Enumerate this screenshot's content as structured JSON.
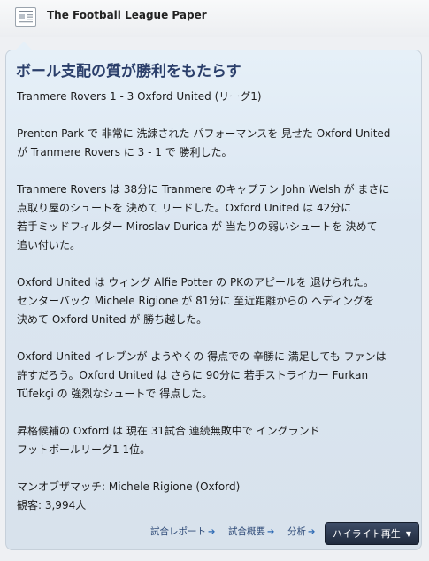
{
  "header": {
    "icon": "newspaper-icon",
    "title": "The Football League Paper"
  },
  "article": {
    "headline": "ボール支配の質が勝利をもたらす",
    "subtitle": "Tranmere Rovers 1 - 3 Oxford United (リーグ1)",
    "p1": [
      "Prenton Park で 非常に 洗練された パフォーマンスを 見せた Oxford United",
      "が Tranmere Rovers に 3 - 1 で 勝利した。"
    ],
    "p2": [
      "Tranmere Rovers は 38分に Tranmere のキャプテン John Welsh が まさに",
      "点取り屋のシュートを 決めて リードした。Oxford United は 42分に",
      "若手ミッドフィルダー Miroslav Durica が 当たりの弱いシュートを 決めて",
      "追い付いた。"
    ],
    "p3": [
      "Oxford United は ウィング Alfie Potter の PKのアピールを 退けられた。",
      "センターバック Michele Rigione が 81分に 至近距離からの ヘディングを",
      "決めて Oxford United が 勝ち越した。"
    ],
    "p4": [
      "Oxford United イレブンが ようやくの 得点での 辛勝に 満足しても ファンは",
      "許すだろう。Oxford United は さらに 90分に 若手ストライカー Furkan",
      "Tüfekçi の 強烈なシュートで 得点した。"
    ],
    "p5": [
      "昇格候補の Oxford は 現在 31試合 連続無敗中で イングランド",
      "フットボールリーグ1 1位。"
    ],
    "motm": "マンオブザマッチ: Michele Rigione (Oxford)",
    "attendance": "観客: 3,994人"
  },
  "footer": {
    "match_report": "試合レポート",
    "match_summary": "試合概要",
    "analysis": "分析",
    "arrow": "➔",
    "highlights": "ハイライト再生",
    "highlights_caret": "▼"
  },
  "colors": {
    "headline": "#2b3f6b",
    "link": "#2f4b78",
    "button": "#1f2a3d"
  }
}
